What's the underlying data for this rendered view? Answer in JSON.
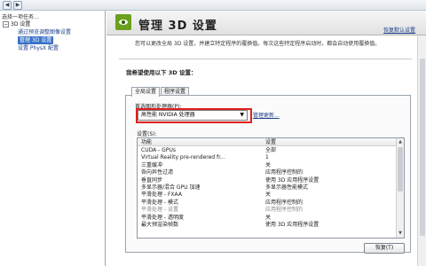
{
  "sidebar": {
    "task_title": "选择一项任务...",
    "items": [
      {
        "label": "3D 设置",
        "toggle": "−"
      },
      {
        "label": "通过预览调整图像设置"
      },
      {
        "label": "管理 3D 设置"
      },
      {
        "label": "设置 PhysX 配置"
      }
    ]
  },
  "header": {
    "title": "管理 3D 设置",
    "restore_link": "恢复默认设置"
  },
  "description": "您可以更改全局 3D 设置，并建立特定程序的覆换值。每次这些特定程序启动时，都会自动使用覆换值。",
  "section_title": "我希望使用以下 3D 设置：",
  "tabs": [
    {
      "label": "全局设置"
    },
    {
      "label": "程序设置"
    }
  ],
  "preferred": {
    "label": "首选图形处理器(P):",
    "value": "高性能 NVIDIA 处理器",
    "refresh_link": "管理更新..."
  },
  "settings": {
    "label": "设置(S):",
    "column_feature": "功能",
    "column_setting": "设置",
    "rows": [
      {
        "feature": "CUDA - GPUs",
        "value": "全部"
      },
      {
        "feature": "Virtual Reality pre-rendered fr...",
        "value": "1"
      },
      {
        "feature": "三重缓冲",
        "value": "关"
      },
      {
        "feature": "各向异性过滤",
        "value": "应用程序控制的"
      },
      {
        "feature": "垂直同步",
        "value": "使用 3D 应用程序设置"
      },
      {
        "feature": "多显示器/混合 GPU 加速",
        "value": "多显示器性能模式"
      },
      {
        "feature": "平滑处理 - FXAA",
        "value": "关"
      },
      {
        "feature": "平滑处理 - 模式",
        "value": "应用程序控制的"
      },
      {
        "feature": "平滑处理 - 设置",
        "value": "应用程序控制的",
        "disabled": true
      },
      {
        "feature": "平滑处理 - 透明度",
        "value": "关"
      },
      {
        "feature": "最大预渲染帧数",
        "value": "使用 3D 应用程序设置"
      }
    ]
  },
  "restore_button": "恢复(T)",
  "colors": {
    "highlight": "#e02020",
    "selection": "#3a73c8",
    "nvidia_green": "#6ba01e"
  },
  "icons": [
    "nvidia-logo-icon",
    "back-arrow-icon",
    "forward-arrow-icon",
    "dropdown-arrow-icon",
    "collapse-toggle-icon"
  ]
}
